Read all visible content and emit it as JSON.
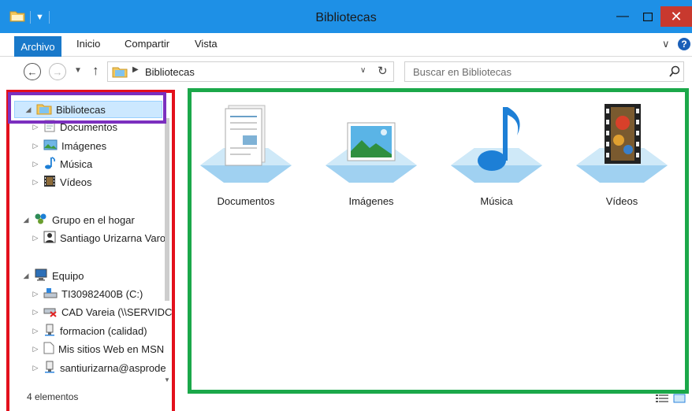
{
  "window": {
    "title": "Bibliotecas"
  },
  "ribbon": {
    "tabs": [
      "Archivo",
      "Inicio",
      "Compartir",
      "Vista"
    ]
  },
  "address": {
    "crumb": "Bibliotecas"
  },
  "search": {
    "placeholder": "Buscar en Bibliotecas"
  },
  "nav": {
    "libraries": "Bibliotecas",
    "library_children": [
      "Documentos",
      "Imágenes",
      "Música",
      "Vídeos"
    ],
    "homegroup": "Grupo en el hogar",
    "homegroup_children": [
      "Santiago Urizarna Varo"
    ],
    "computer": "Equipo",
    "computer_children": [
      "TI30982400B (C:)",
      "CAD Vareia (\\\\SERVIDC",
      "formacion (calidad)",
      "Mis sitios Web en MSN",
      "santiurizarna@asprode"
    ]
  },
  "content": {
    "items": [
      {
        "label": "Documentos",
        "icon": "documents-library-icon"
      },
      {
        "label": "Imágenes",
        "icon": "pictures-library-icon"
      },
      {
        "label": "Música",
        "icon": "music-library-icon"
      },
      {
        "label": "Vídeos",
        "icon": "videos-library-icon"
      }
    ]
  },
  "status": {
    "count": "4 elementos"
  },
  "colors": {
    "titlebar": "#1e90e6",
    "accent": "#1979ca",
    "highlight_red": "#e3101c",
    "highlight_purple": "#7b2fbf",
    "highlight_green": "#1ba84a"
  }
}
